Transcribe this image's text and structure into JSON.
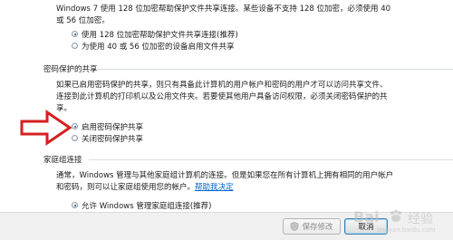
{
  "encryption": {
    "desc_line1": "Windows 7 使用 128 位加密帮助保护文件共享连接。某些设备不支持 128 位加密，必须使用 40",
    "desc_line2": "或 56 位加密。",
    "option1": "使用 128 位加密帮助保护文件共享连接(推荐)",
    "option2": "为使用 40 或 56 位加密的设备启用文件共享"
  },
  "password_sharing": {
    "title": "密码保护的共享",
    "desc_line1": "如果已启用密码保护的共享，则只有具备此计算机的用户帐户和密码的用户才可以访问共享文件、",
    "desc_line2": "连接到此计算机的打印机以及公用文件夹。若要使其他用户具备访问权限，必须关闭密码保护的共",
    "desc_line3": "享。",
    "option_on": "启用密码保护共享",
    "option_off": "关闭密码保护共享"
  },
  "homegroup": {
    "title": "家庭组连接",
    "desc_line1": "通常，Windows 管理与其他家庭组计算机的连接。但是如果您在所有计算机上拥有相同的用户帐户",
    "desc_line2_pre": "和密码，则可以让家庭组使用您的帐户。",
    "help_link": "帮助我决定",
    "option_allow": "允许 Windows 管理家庭组连接(推荐)"
  },
  "buttons": {
    "save": "保存修改",
    "cancel": "取消"
  },
  "watermark": {
    "brand": "Bai",
    "site": "jingyan.baidu.com",
    "suffix": "经验"
  },
  "colors": {
    "arrow": "#d42020",
    "link": "#0066cc"
  }
}
